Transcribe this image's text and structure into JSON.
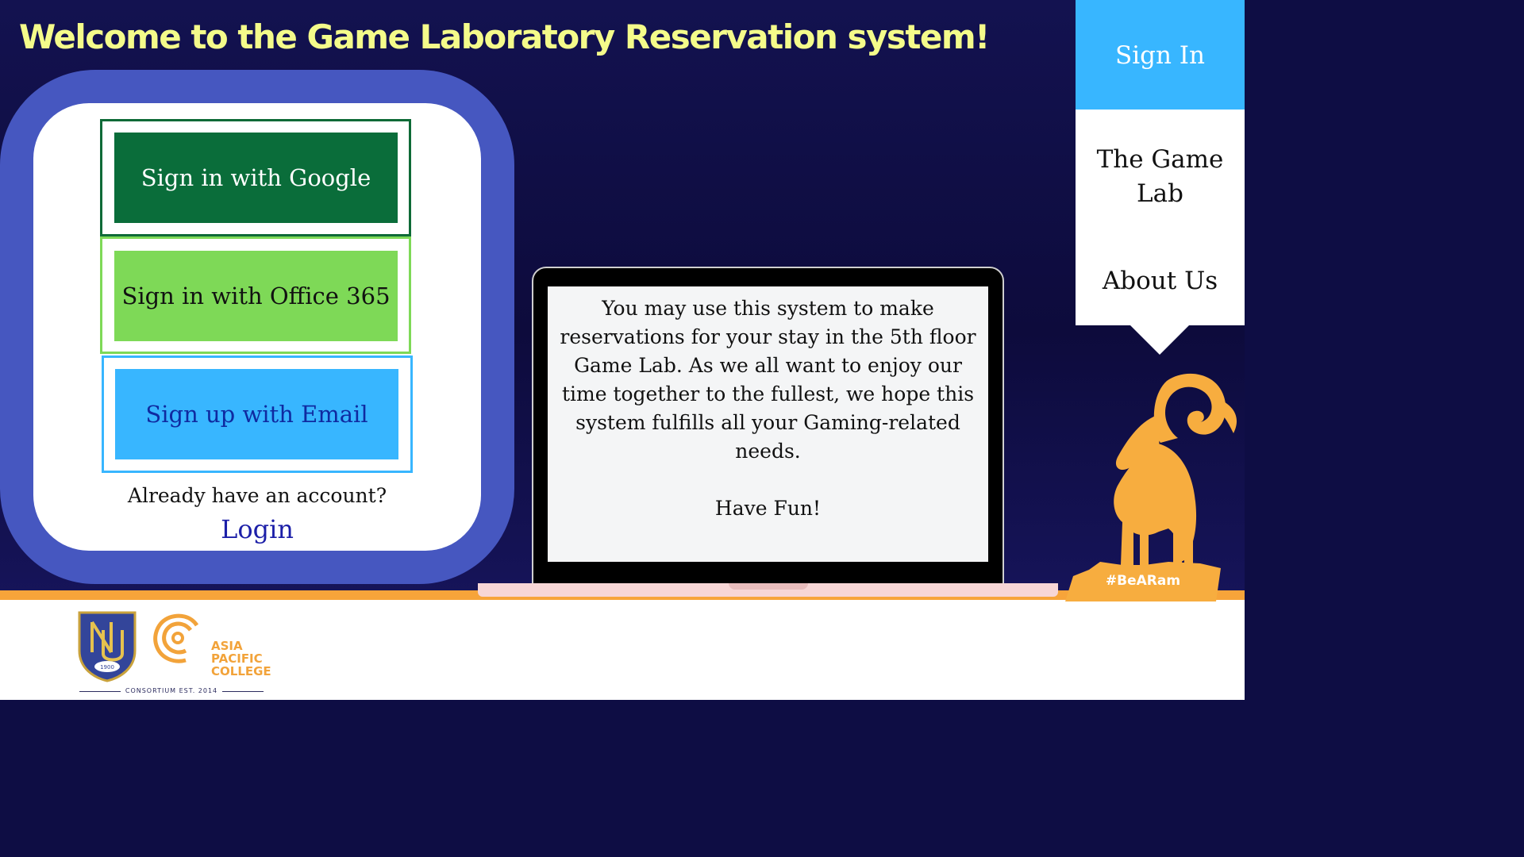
{
  "title": "Welcome to the Game Laboratory Reservation system!",
  "login_card": {
    "google_button": "Sign in with Google",
    "office_button": "Sign in with Office 365",
    "email_button": "Sign up with Email",
    "already_text": "Already have an account?",
    "login_link": "Login"
  },
  "laptop_message": {
    "body": "You may use this system to make reservations for your stay in the 5th floor Game Lab.  As we all want to enjoy our time together to the fullest, we hope this system fulfills all your Gaming-related needs.",
    "closing": "Have Fun!"
  },
  "nav": {
    "sign_in": "Sign In",
    "game_lab": "The Game Lab",
    "about_us": "About Us"
  },
  "mascot": {
    "hashtag": "#BeARam"
  },
  "footer": {
    "nu_year": "1900",
    "apc_lines": [
      "ASIA",
      "PACIFIC",
      "COLLEGE"
    ],
    "consortium": "CONSORTIUM EST. 2014"
  },
  "colors": {
    "background": "#0e0d44",
    "title": "#f4fb8a",
    "card_outer": "#4657c0",
    "google_green": "#0a6d3a",
    "office_green": "#7ed957",
    "email_blue": "#38b6ff",
    "accent_orange": "#f7a43a"
  }
}
